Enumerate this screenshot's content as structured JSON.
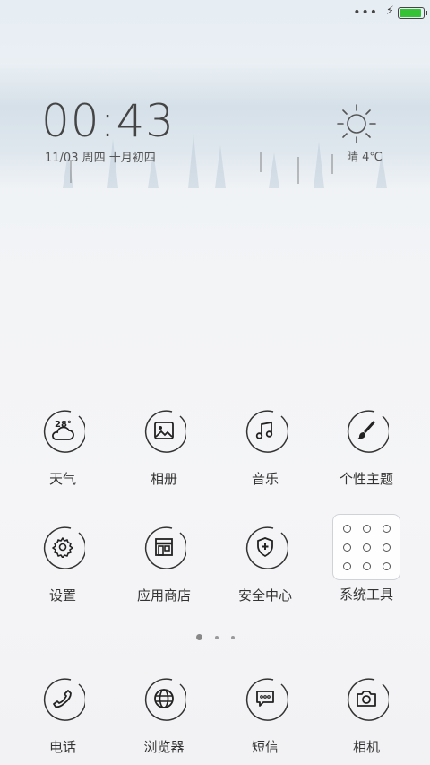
{
  "status": {
    "dots": "•••",
    "charging_icon": "bolt-icon",
    "battery_level": 0.95,
    "battery_color": "#35c235"
  },
  "clock_widget": {
    "time": "00:43",
    "date": "11/03 周四 十月初四",
    "weather_icon": "sun-icon",
    "weather": "晴 4℃"
  },
  "apps_row1": [
    {
      "label": "天气",
      "icon": "weather-icon",
      "badge": "28°"
    },
    {
      "label": "相册",
      "icon": "gallery-icon"
    },
    {
      "label": "音乐",
      "icon": "music-note-icon"
    },
    {
      "label": "个性主题",
      "icon": "paintbrush-icon"
    }
  ],
  "apps_row2": [
    {
      "label": "设置",
      "icon": "gear-icon"
    },
    {
      "label": "应用商店",
      "icon": "store-icon"
    },
    {
      "label": "安全中心",
      "icon": "shield-icon"
    },
    {
      "label": "系统工具",
      "icon": "folder-icon"
    }
  ],
  "page_indicator": {
    "pages": 3,
    "current": 1
  },
  "dock": [
    {
      "label": "电话",
      "icon": "phone-icon"
    },
    {
      "label": "浏览器",
      "icon": "globe-icon"
    },
    {
      "label": "短信",
      "icon": "message-icon"
    },
    {
      "label": "相机",
      "icon": "camera-icon"
    }
  ]
}
